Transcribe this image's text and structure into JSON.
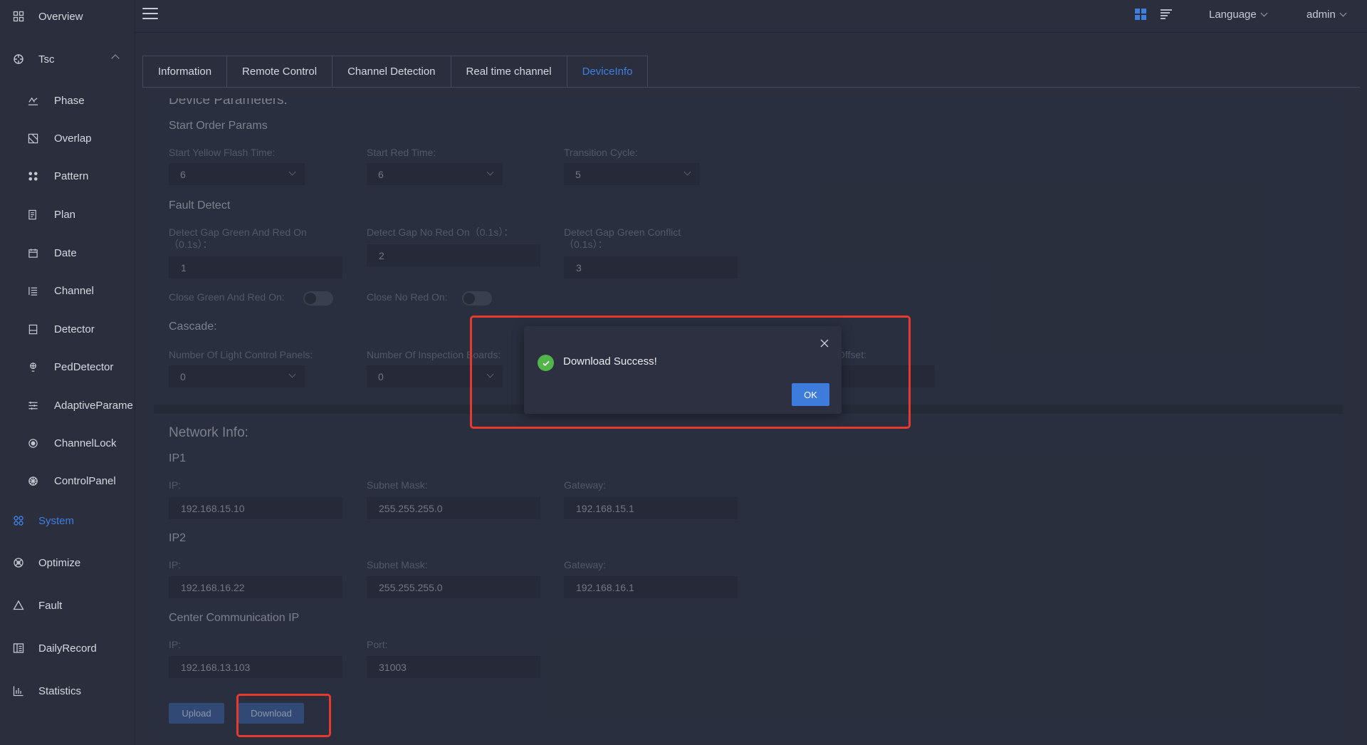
{
  "sidebar": {
    "items": [
      {
        "label": "Overview",
        "icon": "grid-icon"
      },
      {
        "label": "Tsc",
        "icon": "aperture-icon"
      },
      {
        "label": "Phase",
        "icon": "phase-icon"
      },
      {
        "label": "Overlap",
        "icon": "overlap-icon"
      },
      {
        "label": "Pattern",
        "icon": "pattern-icon"
      },
      {
        "label": "Plan",
        "icon": "plan-icon"
      },
      {
        "label": "Date",
        "icon": "calendar-icon"
      },
      {
        "label": "Channel",
        "icon": "list-icon"
      },
      {
        "label": "Detector",
        "icon": "detector-icon"
      },
      {
        "label": "PedDetector",
        "icon": "pedestrian-icon"
      },
      {
        "label": "AdaptiveParame",
        "icon": "sliders-icon"
      },
      {
        "label": "ChannelLock",
        "icon": "lock-circle-icon"
      },
      {
        "label": "ControlPanel",
        "icon": "control-panel-icon"
      },
      {
        "label": "System",
        "icon": "system-icon"
      },
      {
        "label": "Optimize",
        "icon": "optimize-icon"
      },
      {
        "label": "Fault",
        "icon": "fault-icon"
      },
      {
        "label": "DailyRecord",
        "icon": "record-icon"
      },
      {
        "label": "Statistics",
        "icon": "chart-icon"
      }
    ],
    "active_color": "#3f7fe0"
  },
  "header": {
    "language": "Language",
    "user": "admin"
  },
  "tabs": [
    {
      "label": "Information"
    },
    {
      "label": "Remote Control"
    },
    {
      "label": "Channel Detection"
    },
    {
      "label": "Real time channel"
    },
    {
      "label": "DeviceInfo"
    }
  ],
  "device_params": {
    "title": "Device Parameters:",
    "start_order": {
      "title": "Start Order Params",
      "yellow_flash_label": "Start Yellow Flash Time:",
      "yellow_flash_value": "6",
      "red_time_label": "Start Red Time:",
      "red_time_value": "6",
      "transition_label": "Transition Cycle:",
      "transition_value": "5"
    },
    "fault_detect": {
      "title": "Fault Detect",
      "gap_green_red_label": "Detect Gap Green And Red On\n（0.1s）：",
      "gap_green_red_value": "1",
      "gap_no_red_label": "Detect Gap No Red On（0.1s）：",
      "gap_no_red_value": "2",
      "gap_conflict_label": "Detect Gap Green Conflict\n（0.1s）：",
      "gap_conflict_value": "3",
      "close_green_red_label": "Close Green And Red On:",
      "close_no_red_label": "Close No Red On:"
    },
    "cascade": {
      "title": "Cascade:",
      "panels_label": "Number Of Light Control Panels:",
      "panels_value": "0",
      "boards_label": "Number Of Inspection Boards:",
      "boards_value": "0",
      "offset_label": "Offset:"
    }
  },
  "network": {
    "title": "Network Info:",
    "ip1": {
      "title": "IP1",
      "ip_label": "IP:",
      "ip": "192.168.15.10",
      "mask_label": "Subnet Mask:",
      "mask": "255.255.255.0",
      "gw_label": "Gateway:",
      "gw": "192.168.15.1"
    },
    "ip2": {
      "title": "IP2",
      "ip_label": "IP:",
      "ip": "192.168.16.22",
      "mask_label": "Subnet Mask:",
      "mask": "255.255.255.0",
      "gw_label": "Gateway:",
      "gw": "192.168.16.1"
    },
    "center": {
      "title": "Center Communication IP",
      "ip_label": "IP:",
      "ip": "192.168.13.103",
      "port_label": "Port:",
      "port": "31003"
    }
  },
  "actions": {
    "upload": "Upload",
    "download": "Download"
  },
  "dialog": {
    "message": "Download Success!",
    "ok": "OK",
    "success_color": "#52b54a",
    "highlight_color": "#e8392e"
  }
}
